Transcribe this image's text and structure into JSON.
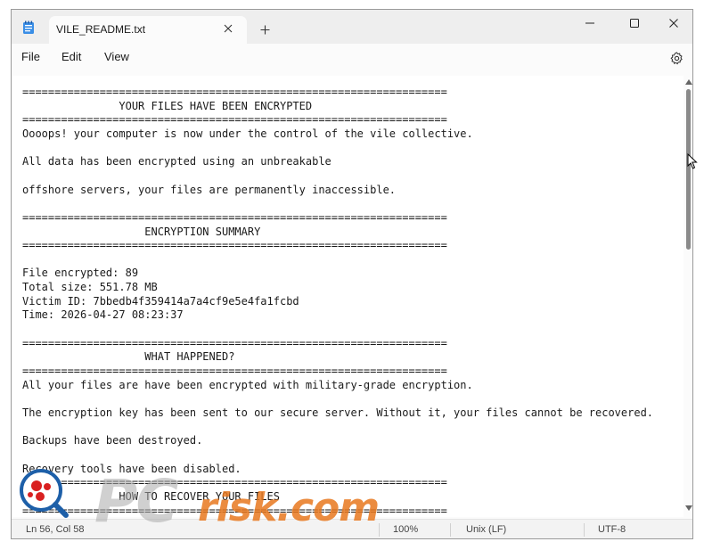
{
  "window": {
    "tab_title": "VILE_README.txt",
    "icons": {
      "app": "notepad-icon",
      "tab_close": "close-icon",
      "new_tab": "plus-icon",
      "minimize": "minimize-icon",
      "maximize": "maximize-icon",
      "close": "close-icon",
      "settings": "gear-icon"
    }
  },
  "menu": {
    "file": "File",
    "edit": "Edit",
    "view": "View"
  },
  "document": {
    "lines": [
      "==================================================================",
      "               YOUR FILES HAVE BEEN ENCRYPTED",
      "==================================================================",
      "Oooops! your computer is now under the control of the vile collective.",
      "",
      "All data has been encrypted using an unbreakable",
      "",
      "offshore servers, your files are permanently inaccessible.",
      "",
      "==================================================================",
      "                   ENCRYPTION SUMMARY",
      "==================================================================",
      "",
      "File encrypted: 89",
      "Total size: 551.78 MB",
      "Victim ID: 7bbedb4f359414a7a4cf9e5e4fa1fcbd",
      "Time: 2026-04-27 08:23:37",
      "",
      "==================================================================",
      "                   WHAT HAPPENED?",
      "==================================================================",
      "All your files are have been encrypted with military-grade encryption.",
      "",
      "The encryption key has been sent to our secure server. Without it, your files cannot be recovered.",
      "",
      "Backups have been destroyed.",
      "",
      "Recovery tools have been disabled.",
      "==================================================================",
      "               HOW TO RECOVER YOUR FILES",
      "=================================================================="
    ]
  },
  "status": {
    "position": "Ln 56, Col 58",
    "zoom": "100%",
    "line_ending": "Unix (LF)",
    "encoding": "UTF-8"
  },
  "watermark": {
    "pc": "PC",
    "risk": "risk.com"
  },
  "colors": {
    "accent": "#1a1a1a",
    "watermark_orange": "#e8781e",
    "magnifier_red": "#d92020",
    "magnifier_blue": "#1d5fa8"
  }
}
